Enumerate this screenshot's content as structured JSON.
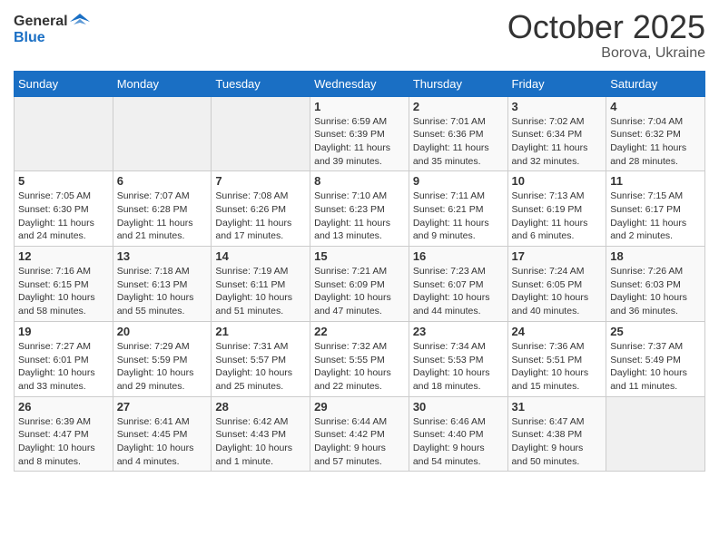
{
  "header": {
    "logo_line1": "General",
    "logo_line2": "Blue",
    "month": "October 2025",
    "location": "Borova, Ukraine"
  },
  "weekdays": [
    "Sunday",
    "Monday",
    "Tuesday",
    "Wednesday",
    "Thursday",
    "Friday",
    "Saturday"
  ],
  "weeks": [
    [
      {
        "day": "",
        "content": ""
      },
      {
        "day": "",
        "content": ""
      },
      {
        "day": "",
        "content": ""
      },
      {
        "day": "1",
        "content": "Sunrise: 6:59 AM\nSunset: 6:39 PM\nDaylight: 11 hours\nand 39 minutes."
      },
      {
        "day": "2",
        "content": "Sunrise: 7:01 AM\nSunset: 6:36 PM\nDaylight: 11 hours\nand 35 minutes."
      },
      {
        "day": "3",
        "content": "Sunrise: 7:02 AM\nSunset: 6:34 PM\nDaylight: 11 hours\nand 32 minutes."
      },
      {
        "day": "4",
        "content": "Sunrise: 7:04 AM\nSunset: 6:32 PM\nDaylight: 11 hours\nand 28 minutes."
      }
    ],
    [
      {
        "day": "5",
        "content": "Sunrise: 7:05 AM\nSunset: 6:30 PM\nDaylight: 11 hours\nand 24 minutes."
      },
      {
        "day": "6",
        "content": "Sunrise: 7:07 AM\nSunset: 6:28 PM\nDaylight: 11 hours\nand 21 minutes."
      },
      {
        "day": "7",
        "content": "Sunrise: 7:08 AM\nSunset: 6:26 PM\nDaylight: 11 hours\nand 17 minutes."
      },
      {
        "day": "8",
        "content": "Sunrise: 7:10 AM\nSunset: 6:23 PM\nDaylight: 11 hours\nand 13 minutes."
      },
      {
        "day": "9",
        "content": "Sunrise: 7:11 AM\nSunset: 6:21 PM\nDaylight: 11 hours\nand 9 minutes."
      },
      {
        "day": "10",
        "content": "Sunrise: 7:13 AM\nSunset: 6:19 PM\nDaylight: 11 hours\nand 6 minutes."
      },
      {
        "day": "11",
        "content": "Sunrise: 7:15 AM\nSunset: 6:17 PM\nDaylight: 11 hours\nand 2 minutes."
      }
    ],
    [
      {
        "day": "12",
        "content": "Sunrise: 7:16 AM\nSunset: 6:15 PM\nDaylight: 10 hours\nand 58 minutes."
      },
      {
        "day": "13",
        "content": "Sunrise: 7:18 AM\nSunset: 6:13 PM\nDaylight: 10 hours\nand 55 minutes."
      },
      {
        "day": "14",
        "content": "Sunrise: 7:19 AM\nSunset: 6:11 PM\nDaylight: 10 hours\nand 51 minutes."
      },
      {
        "day": "15",
        "content": "Sunrise: 7:21 AM\nSunset: 6:09 PM\nDaylight: 10 hours\nand 47 minutes."
      },
      {
        "day": "16",
        "content": "Sunrise: 7:23 AM\nSunset: 6:07 PM\nDaylight: 10 hours\nand 44 minutes."
      },
      {
        "day": "17",
        "content": "Sunrise: 7:24 AM\nSunset: 6:05 PM\nDaylight: 10 hours\nand 40 minutes."
      },
      {
        "day": "18",
        "content": "Sunrise: 7:26 AM\nSunset: 6:03 PM\nDaylight: 10 hours\nand 36 minutes."
      }
    ],
    [
      {
        "day": "19",
        "content": "Sunrise: 7:27 AM\nSunset: 6:01 PM\nDaylight: 10 hours\nand 33 minutes."
      },
      {
        "day": "20",
        "content": "Sunrise: 7:29 AM\nSunset: 5:59 PM\nDaylight: 10 hours\nand 29 minutes."
      },
      {
        "day": "21",
        "content": "Sunrise: 7:31 AM\nSunset: 5:57 PM\nDaylight: 10 hours\nand 25 minutes."
      },
      {
        "day": "22",
        "content": "Sunrise: 7:32 AM\nSunset: 5:55 PM\nDaylight: 10 hours\nand 22 minutes."
      },
      {
        "day": "23",
        "content": "Sunrise: 7:34 AM\nSunset: 5:53 PM\nDaylight: 10 hours\nand 18 minutes."
      },
      {
        "day": "24",
        "content": "Sunrise: 7:36 AM\nSunset: 5:51 PM\nDaylight: 10 hours\nand 15 minutes."
      },
      {
        "day": "25",
        "content": "Sunrise: 7:37 AM\nSunset: 5:49 PM\nDaylight: 10 hours\nand 11 minutes."
      }
    ],
    [
      {
        "day": "26",
        "content": "Sunrise: 6:39 AM\nSunset: 4:47 PM\nDaylight: 10 hours\nand 8 minutes."
      },
      {
        "day": "27",
        "content": "Sunrise: 6:41 AM\nSunset: 4:45 PM\nDaylight: 10 hours\nand 4 minutes."
      },
      {
        "day": "28",
        "content": "Sunrise: 6:42 AM\nSunset: 4:43 PM\nDaylight: 10 hours\nand 1 minute."
      },
      {
        "day": "29",
        "content": "Sunrise: 6:44 AM\nSunset: 4:42 PM\nDaylight: 9 hours\nand 57 minutes."
      },
      {
        "day": "30",
        "content": "Sunrise: 6:46 AM\nSunset: 4:40 PM\nDaylight: 9 hours\nand 54 minutes."
      },
      {
        "day": "31",
        "content": "Sunrise: 6:47 AM\nSunset: 4:38 PM\nDaylight: 9 hours\nand 50 minutes."
      },
      {
        "day": "",
        "content": ""
      }
    ]
  ]
}
